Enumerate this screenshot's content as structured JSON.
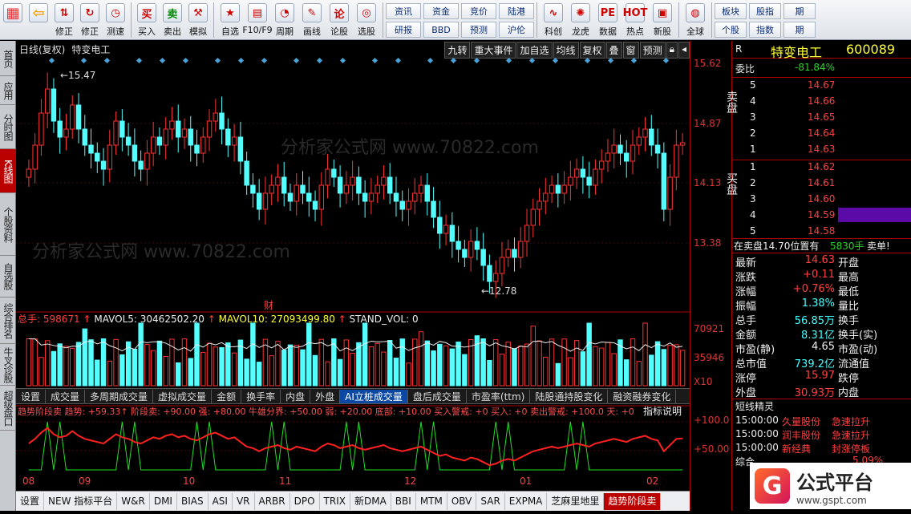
{
  "toolbar": {
    "left": [
      {
        "icon": "windows-logo-icon",
        "label": ""
      },
      {
        "icon": "back-arrow-icon",
        "label": ""
      },
      {
        "icon": "up-down-arrow-icon",
        "label": "修正"
      },
      {
        "icon": "refresh-icon",
        "label": "修正"
      },
      {
        "icon": "clock-icon",
        "label": "测速"
      }
    ],
    "trade": [
      {
        "icon": "buy-icon",
        "glyph": "买",
        "label": "买入"
      },
      {
        "icon": "sell-icon",
        "glyph": "卖",
        "label": "卖出"
      },
      {
        "icon": "hammer-icon",
        "glyph": "⚒",
        "label": "模拟"
      }
    ],
    "tools": [
      {
        "icon": "star-icon",
        "label": "自选"
      },
      {
        "icon": "f10-icon",
        "label": "F10/F9"
      },
      {
        "icon": "period-icon",
        "label": "周期"
      },
      {
        "icon": "pencil-icon",
        "label": "画线"
      },
      {
        "icon": "forum-icon",
        "label": "论股"
      },
      {
        "icon": "select-stock-icon",
        "label": "选股"
      }
    ],
    "grid1": [
      "资讯",
      "资金",
      "竞价",
      "陆港",
      "研报",
      "BBD",
      "预测",
      "沪伦"
    ],
    "tools2": [
      {
        "icon": "kecang-icon",
        "label": "科创"
      },
      {
        "icon": "dragon-tiger-icon",
        "label": "龙虎"
      },
      {
        "icon": "pe-data-icon",
        "label": "数据"
      },
      {
        "icon": "hot-icon",
        "label": "热点"
      },
      {
        "icon": "new-stock-icon",
        "label": "新股"
      }
    ],
    "global": {
      "icon": "globe-icon",
      "label": "全球"
    },
    "grid2": [
      "板块",
      "股指",
      "期",
      "个股",
      "指数",
      "期"
    ]
  },
  "sidebar": [
    "首页",
    "应用",
    "分时图",
    "K线图",
    "个股资料",
    "自选股",
    "综合排名",
    "牛叉诊股",
    "超级盘口"
  ],
  "sidebar_active": 3,
  "chart": {
    "title": "日线(复权)",
    "stock": "特变电工",
    "buttons": [
      "九转",
      "重大事件",
      "加自选",
      "均线",
      "复权",
      "叠",
      "窗",
      "预测"
    ],
    "high_label": "15.47",
    "low_label": "12.78",
    "cai_label": "财",
    "price_levels": [
      "15.62",
      "14.87",
      "14.13",
      "13.38"
    ],
    "vol_info": {
      "total": "总手: 598671",
      "mavol5": "MAVOL5: 30462502.20",
      "mavol10": "MAVOL10: 27093499.80",
      "std": "STAND_VOL: 0"
    },
    "vol_levels": [
      "70921",
      "35946",
      "X10"
    ],
    "indicator_tabs": [
      "设置",
      "成交量",
      "多周期成交量",
      "虚拟成交量",
      "金额",
      "换手率",
      "内盘",
      "外盘",
      "AI立桩成交量",
      "盘后成交量",
      "市盈率(ttm)",
      "陆股通持股变化",
      "融资融券变化"
    ],
    "indicator_tab_active": 8,
    "ind_info": "趋势阶段卖  趋势: +59.33↑ 阶段卖: +90.00  强: +80.00  牛雄分界: +50.00  弱: +20.00  底部: +10.00  买入警戒: +0  买入: +0  卖出警戒: +100.0  天: +0",
    "ind_help": "指标说明",
    "ind_levels": [
      "+100.0",
      "+50.00"
    ],
    "months": [
      "08",
      "09",
      "10",
      "11",
      "12",
      "01",
      "02"
    ],
    "bottom_tabs": [
      "设置",
      "NEW 指标平台",
      "W&R",
      "DMI",
      "BIAS",
      "ASI",
      "VR",
      "ARBR",
      "DPO",
      "TRIX",
      "新DMA",
      "BBI",
      "MTM",
      "OBV",
      "SAR",
      "EXPMA",
      "芝麻里地里",
      "趋势阶段卖"
    ],
    "bottom_active": 17,
    "watermark": "分析家公式网 www.70822.com"
  },
  "quote": {
    "code": "R",
    "name": "特变电工",
    "id": "600089",
    "weibi_label": "委比",
    "weibi": "-81.84%",
    "sell": [
      {
        "n": "5",
        "p": "14.67"
      },
      {
        "n": "4",
        "p": "14.66"
      },
      {
        "n": "3",
        "p": "14.65"
      },
      {
        "n": "2",
        "p": "14.64"
      },
      {
        "n": "1",
        "p": "14.63"
      }
    ],
    "buy": [
      {
        "n": "1",
        "p": "14.62"
      },
      {
        "n": "2",
        "p": "14.61"
      },
      {
        "n": "3",
        "p": "14.60"
      },
      {
        "n": "4",
        "p": "14.59"
      },
      {
        "n": "5",
        "p": "14.58"
      }
    ],
    "sell_label": "卖盘",
    "buy_label": "买盘",
    "ticker": "在卖盘14.70位置有",
    "ticker_qty": "5830手",
    "ticker_tail": "卖单!",
    "stats": [
      {
        "k": "最新",
        "v": "14.63",
        "c": "red",
        "k2": "开盘"
      },
      {
        "k": "涨跌",
        "v": "+0.11",
        "c": "red",
        "k2": "最高"
      },
      {
        "k": "涨幅",
        "v": "+0.76%",
        "c": "red",
        "k2": "最低"
      },
      {
        "k": "振幅",
        "v": "1.38%",
        "c": "cyn",
        "k2": "量比"
      },
      {
        "k": "总手",
        "v": "56.85万",
        "c": "cyn",
        "k2": "换手"
      },
      {
        "k": "金额",
        "v": "8.31亿",
        "c": "cyn",
        "k2": "换手(实)"
      },
      {
        "k": "市盈(静)",
        "v": "4.65",
        "c": "wht",
        "k2": "市盈(动)"
      },
      {
        "k": "总市值",
        "v": "739.2亿",
        "c": "cyn",
        "k2": "流通值"
      },
      {
        "k": "涨停",
        "v": "15.97",
        "c": "red",
        "k2": "跌停"
      },
      {
        "k": "外盘",
        "v": "30.93万",
        "c": "red",
        "k2": "内盘"
      }
    ],
    "sprite_title": "短线精灵",
    "sprites": [
      {
        "t": "15:00:00",
        "n": "久量股份",
        "e": "急速拉升"
      },
      {
        "t": "15:00:00",
        "n": "润丰股份",
        "e": "急速拉升"
      },
      {
        "t": "15:00:00",
        "n": "新经典",
        "e": "封涨停板"
      }
    ],
    "footer": "综合",
    "footer_pct": "5.09%",
    "brand": "公式平台",
    "brand_url": "www.gspt.com"
  },
  "chart_data": {
    "type": "candlestick",
    "title": "特变电工 日线(复权)",
    "x_months": [
      "08",
      "09",
      "10",
      "11",
      "12",
      "01",
      "02"
    ],
    "y_range": [
      12.6,
      15.7
    ],
    "marked_high": 15.47,
    "marked_low": 12.78,
    "closes": [
      14.3,
      14.6,
      15.0,
      15.3,
      14.9,
      14.7,
      14.8,
      15.1,
      14.8,
      14.6,
      14.5,
      14.4,
      14.3,
      14.6,
      14.9,
      14.7,
      14.6,
      14.4,
      14.3,
      14.5,
      14.7,
      14.6,
      14.8,
      14.9,
      14.7,
      14.8,
      14.6,
      14.5,
      14.7,
      14.9,
      15.0,
      14.8,
      14.6,
      14.7,
      14.4,
      14.1,
      14.0,
      13.8,
      14.0,
      14.1,
      14.2,
      14.0,
      13.9,
      14.1,
      14.0,
      13.9,
      13.8,
      14.1,
      14.3,
      14.2,
      14.0,
      14.1,
      14.2,
      14.0,
      13.9,
      14.0,
      14.1,
      14.2,
      14.0,
      13.9,
      13.8,
      13.9,
      14.0,
      14.1,
      13.9,
      13.7,
      13.5,
      13.6,
      13.4,
      13.3,
      13.2,
      13.4,
      13.3,
      13.1,
      12.9,
      13.0,
      13.2,
      13.3,
      13.2,
      13.4,
      13.6,
      13.8,
      13.9,
      14.0,
      14.1,
      14.0,
      14.1,
      14.2,
      14.3,
      14.2,
      14.1,
      14.3,
      14.4,
      14.5,
      14.6,
      14.5,
      14.4,
      14.6,
      14.7,
      14.8,
      14.6,
      14.5,
      13.8,
      14.2,
      14.6,
      14.63
    ],
    "volume_range": [
      0,
      70921
    ]
  }
}
